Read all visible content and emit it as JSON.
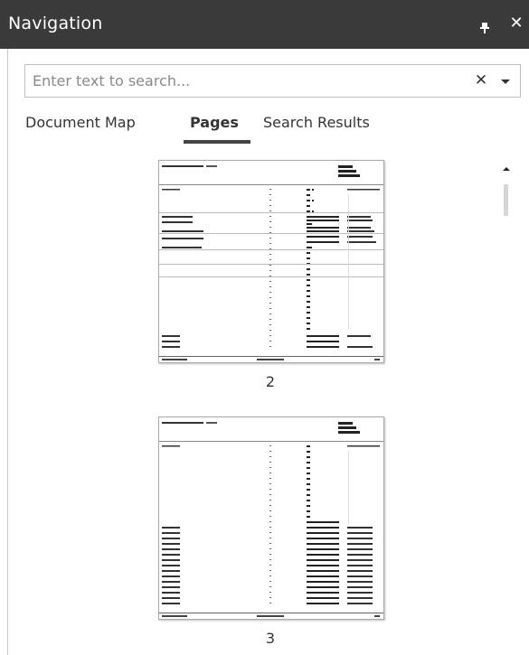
{
  "panel": {
    "title": "Navigation",
    "pin_icon": "pin-icon",
    "close_icon": "close-icon",
    "close_glyph": "✕"
  },
  "search": {
    "placeholder": "Enter text to search...",
    "value": "",
    "clear_glyph": "✕",
    "clear_icon": "clear-icon",
    "dropdown_icon": "chevron-down-icon"
  },
  "tabs": [
    {
      "label": "Document Map",
      "active": false
    },
    {
      "label": "Pages",
      "active": true
    },
    {
      "label": "Search Results",
      "active": false
    }
  ],
  "pages": [
    {
      "number": "2"
    },
    {
      "number": "3"
    }
  ]
}
